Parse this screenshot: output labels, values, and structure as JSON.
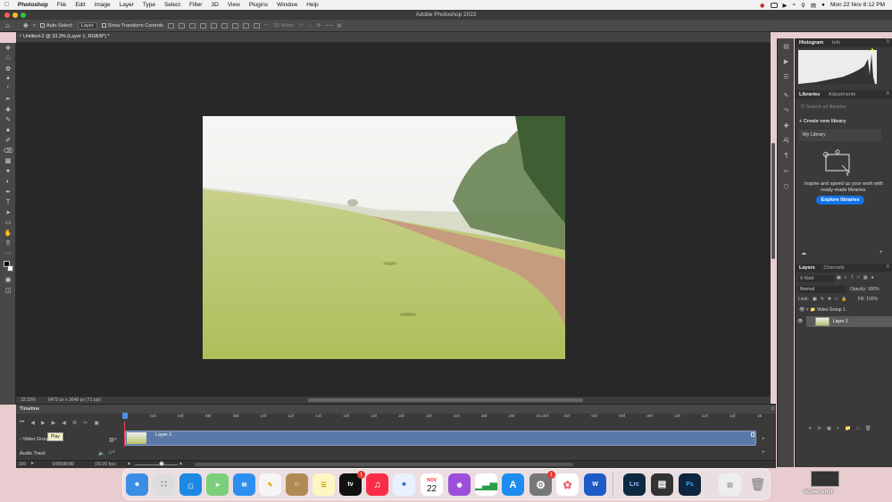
{
  "menubar": {
    "app": "Photoshop",
    "items": [
      "File",
      "Edit",
      "Image",
      "Layer",
      "Type",
      "Select",
      "Filter",
      "3D",
      "View",
      "Plugins",
      "Window",
      "Help"
    ],
    "datetime": "Mon 22 Nov  8:12 PM"
  },
  "window": {
    "title": "Adobe Photoshop 2022"
  },
  "options": {
    "auto_select": "Auto-Select:",
    "auto_select_value": "Layer",
    "transform": "Show Transform Controls",
    "mode3d": "3D Mode:"
  },
  "document": {
    "tab": "Untitled-2 @ 33.3% (Layer 1, RGB/8*) *",
    "zoom": "33.33%",
    "info": "6472 px x 3648 px (72 ppi)"
  },
  "timeline": {
    "title": "Timeline",
    "video_group": "Video Group 1",
    "audio": "Audio Track",
    "layer_clip": "Layer 1",
    "tooltip": "Play",
    "timecode": "0:00:00:00",
    "fps": "(30.00 fps)",
    "frame": "000",
    "ticks": [
      "02f",
      "04f",
      "06f",
      "08f",
      "10f",
      "12f",
      "14f",
      "16f",
      "18f",
      "20f",
      "22f",
      "24f",
      "26f",
      "28f",
      "01:00f",
      "02f",
      "04f",
      "06f",
      "08f",
      "10f",
      "12f",
      "14f",
      "16"
    ]
  },
  "panels": {
    "histogram": {
      "tabs": [
        "Histogram",
        "Info"
      ]
    },
    "libraries": {
      "tabs": [
        "Libraries",
        "Adjustments"
      ],
      "search_placeholder": "Search all libraries",
      "create": "Create new library",
      "my_library": "My Library",
      "promo": "Inspire and speed up your work with ready-made libraries.",
      "explore": "Explore libraries"
    },
    "layers": {
      "tabs": [
        "Layers",
        "Channels"
      ],
      "kind": "Kind",
      "blend": "Normal",
      "opacity_label": "Opacity:",
      "opacity": "100%",
      "lock_label": "Lock:",
      "fill_label": "Fill:",
      "fill": "100%",
      "group": "Video Group 1",
      "layer": "Layer 1"
    }
  },
  "dock": {
    "calendar_month": "NOV",
    "calendar_day": "22",
    "badge_music": "1",
    "badge_settings": "1",
    "lrc": "Lrc",
    "ps": "Ps",
    "word": "W",
    "tv": "tv",
    "screenshot_label": "Screenshot"
  },
  "colors": {
    "accent": "#1473e6",
    "track": "#5a79a8",
    "canvas": "#282828"
  }
}
